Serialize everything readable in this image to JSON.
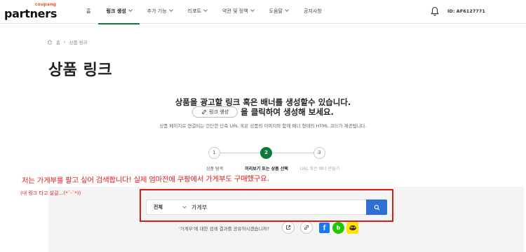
{
  "header": {
    "logo_small": "coupang",
    "logo_main": "partners",
    "nav": [
      {
        "label": "홈",
        "dropdown": false,
        "active": false
      },
      {
        "label": "링크 생성",
        "dropdown": true,
        "active": true
      },
      {
        "label": "추가 기능",
        "dropdown": true,
        "active": false
      },
      {
        "label": "리포트",
        "dropdown": true,
        "active": false
      },
      {
        "label": "약관 및 정책",
        "dropdown": true,
        "active": false
      },
      {
        "label": "도움말",
        "dropdown": true,
        "active": false
      },
      {
        "label": "공지사항",
        "dropdown": false,
        "active": false
      }
    ],
    "user_id": "ID: AF6127771"
  },
  "breadcrumb": {
    "home": "홈",
    "current": "상품 링크"
  },
  "page_title": "상품 링크",
  "intro": {
    "line1": "상품을 광고할 링크 혹은 배너를 생성할수 있습니다.",
    "chip_label": "링크 생성",
    "line2_suffix": "을 클릭하여 생성해 보세요.",
    "line3": "상품 페이지로 연결되는 간단한 단축 URL 혹은 상품의 이미지와 함께 배너 형태의 HTML 코드가 제공됩니다."
  },
  "steps": [
    {
      "number": "1",
      "label": "상품 탐색",
      "state": "done"
    },
    {
      "number": "2",
      "label": "미리보기 또는 상품 선택",
      "state": "active"
    },
    {
      "number": "3",
      "label": "URL 혹은 배너 만들기",
      "state": "pending"
    }
  ],
  "search": {
    "category": "전체",
    "query": "가게부",
    "share_text": "'가게부'에 대한 검색 결과를 공유하시겠습니까?"
  },
  "annotation": {
    "line1": "저는 가게부를 팔고 싶어 검색합니다! 실제 엄마전에 쿠팡에서 가게부도 구매했구요.",
    "line2": "(내 링크 타고 살걸…(*´-`*))"
  },
  "colors": {
    "accent_green": "#0d7a3a",
    "search_blue": "#2f6fd6",
    "annotation_red": "#e02020"
  }
}
